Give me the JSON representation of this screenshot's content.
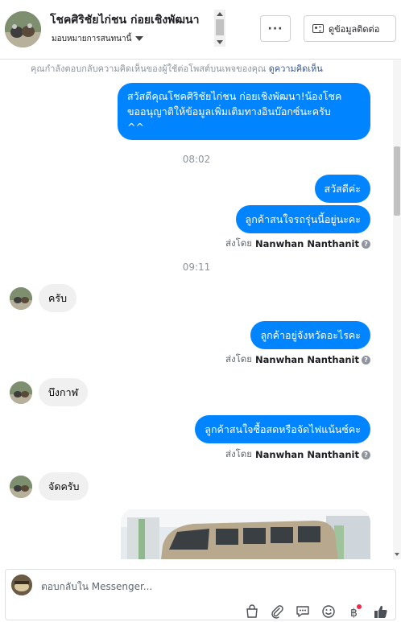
{
  "header": {
    "name": "โชคศิริชัยไก่ชน ก่อยเชิงพัฒนา",
    "assign_label": "มอบหมายการสนทนานี้",
    "more_label": "···",
    "contact_label": "ดูข้อมูลติดต่อ"
  },
  "notice": {
    "text": "คุณกำลังตอบกลับความคิดเห็นของผู้ใช้ต่อโพสต์บนเพจของคุณ",
    "link": "ดูความคิดเห็น"
  },
  "messages": {
    "m1_line1": "สวัสดีคุณโชคศิริชัยไก่ชน ก่อยเชิงพัฒนา!น้องโชค",
    "m1_line2": "ขออนุญาติให้ข้อมูลเพิ่มเติมทางอินบ๊อกซ์นะครับ",
    "m1_line3": "^^",
    "time1": "08:02",
    "m2": "สวัสดีค่ะ",
    "m3": "ลูกค้าสนใจรถรุ่นนี้อยู่นะคะ",
    "sent_prefix": "ส่งโดย",
    "sent_name": "Nanwhan Nanthanit",
    "time2": "09:11",
    "m4": "ครับ",
    "m5": "ลูกค้าอยู่จังหวัดอะไรคะ",
    "m6": "บึงกาฬ",
    "m7": "ลูกค้าสนใจซื้อสดหรือจัดไฟแน้นซ์คะ",
    "m8": "จัดครับ"
  },
  "composer": {
    "placeholder": "ตอบกลับใน Messenger..."
  },
  "icons": [
    "bag-icon",
    "attachment-icon",
    "quick-reply-icon",
    "emoji-icon",
    "baht-icon",
    "thumbs-up-icon"
  ],
  "colors": {
    "accent": "#0084ff",
    "incoming": "#f1f0f0",
    "like": "#4b4f56",
    "badge": "#f02849"
  }
}
